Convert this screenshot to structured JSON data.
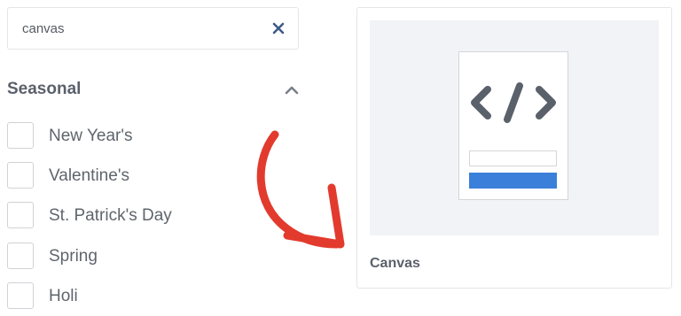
{
  "search": {
    "value": "canvas",
    "clear_icon": "close-icon"
  },
  "filters": {
    "section_title": "Seasonal",
    "collapse_icon": "chevron-up-icon",
    "items": [
      {
        "label": "New Year's",
        "checked": false
      },
      {
        "label": "Valentine's",
        "checked": false
      },
      {
        "label": "St. Patrick's Day",
        "checked": false
      },
      {
        "label": "Spring",
        "checked": false
      },
      {
        "label": "Holi",
        "checked": false
      }
    ]
  },
  "template_card": {
    "title": "Canvas",
    "preview_icon": "code-icon"
  },
  "colors": {
    "accent_blue": "#3a7fd9",
    "arrow_red": "#e23b2e",
    "icon_gray": "#5b616b"
  }
}
